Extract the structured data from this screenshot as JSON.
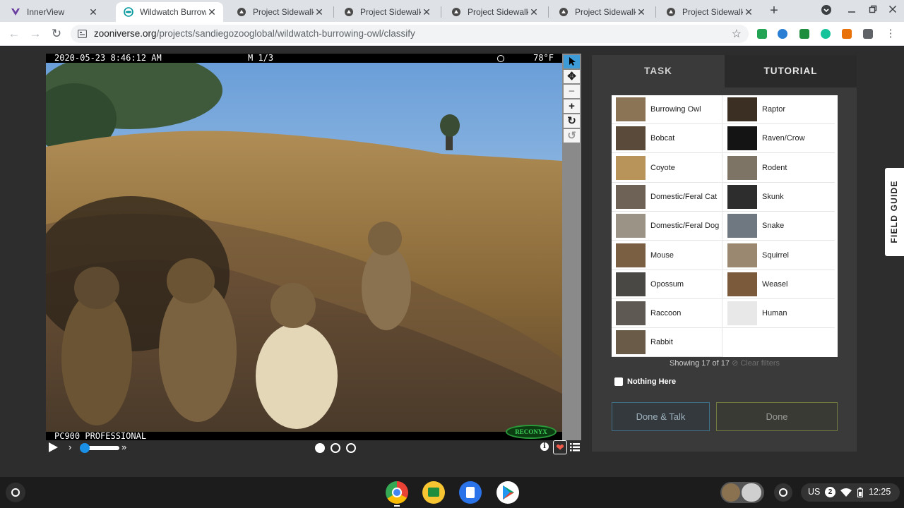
{
  "browser": {
    "tabs": [
      {
        "title": "InnerView",
        "icon": "innerview-icon"
      },
      {
        "title": "Wildwatch Burrowing Owl",
        "icon": "zooniverse-icon",
        "active": true
      },
      {
        "title": "Project Sidewalk - ",
        "icon": "sidewalk-icon"
      },
      {
        "title": "Project Sidewalk - ",
        "icon": "sidewalk-icon"
      },
      {
        "title": "Project Sidewalk - ",
        "icon": "sidewalk-icon"
      },
      {
        "title": "Project Sidewalk - ",
        "icon": "sidewalk-icon"
      },
      {
        "title": "Project Sidewalk - ",
        "icon": "sidewalk-icon"
      }
    ],
    "new_tab": "+",
    "url_domain": "zooniverse.org",
    "url_path": "/projects/sandiegozooglobal/wildwatch-burrowing-owl/classify"
  },
  "camera": {
    "timestamp": "2020-05-23 8:46:12 AM",
    "mode": "M 1/3",
    "temperature": "78°F",
    "model": "PC900 PROFESSIONAL",
    "brand": "RECONYX"
  },
  "viewer_tools": [
    "pointer-icon",
    "move-icon",
    "zoom-out-icon",
    "zoom-in-icon",
    "rotate-icon",
    "reset-icon"
  ],
  "frames": {
    "total": 3,
    "current": 1
  },
  "panel": {
    "tab_task": "TASK",
    "tab_tutorial": "TUTORIAL",
    "choices_left": [
      "Burrowing Owl",
      "Bobcat",
      "Coyote",
      "Domestic/Feral Cat",
      "Domestic/Feral Dog",
      "Mouse",
      "Opossum",
      "Raccoon",
      "Rabbit"
    ],
    "choices_right": [
      "Raptor",
      "Raven/Crow",
      "Rodent",
      "Skunk",
      "Snake",
      "Squirrel",
      "Weasel",
      "Human"
    ],
    "showing": "Showing 17 of 17",
    "clear_filters": "Clear filters",
    "nothing_here": "Nothing Here",
    "done_talk": "Done & Talk",
    "done": "Done"
  },
  "field_guide": "FIELD GUIDE",
  "tray": {
    "ime": "US",
    "notifications": "2",
    "time": "12:25"
  },
  "colors": {
    "accent": "#1a8fe6",
    "panel": "#3a3a3a",
    "page": "#2d2d2d",
    "heart": "#f05a4a"
  }
}
